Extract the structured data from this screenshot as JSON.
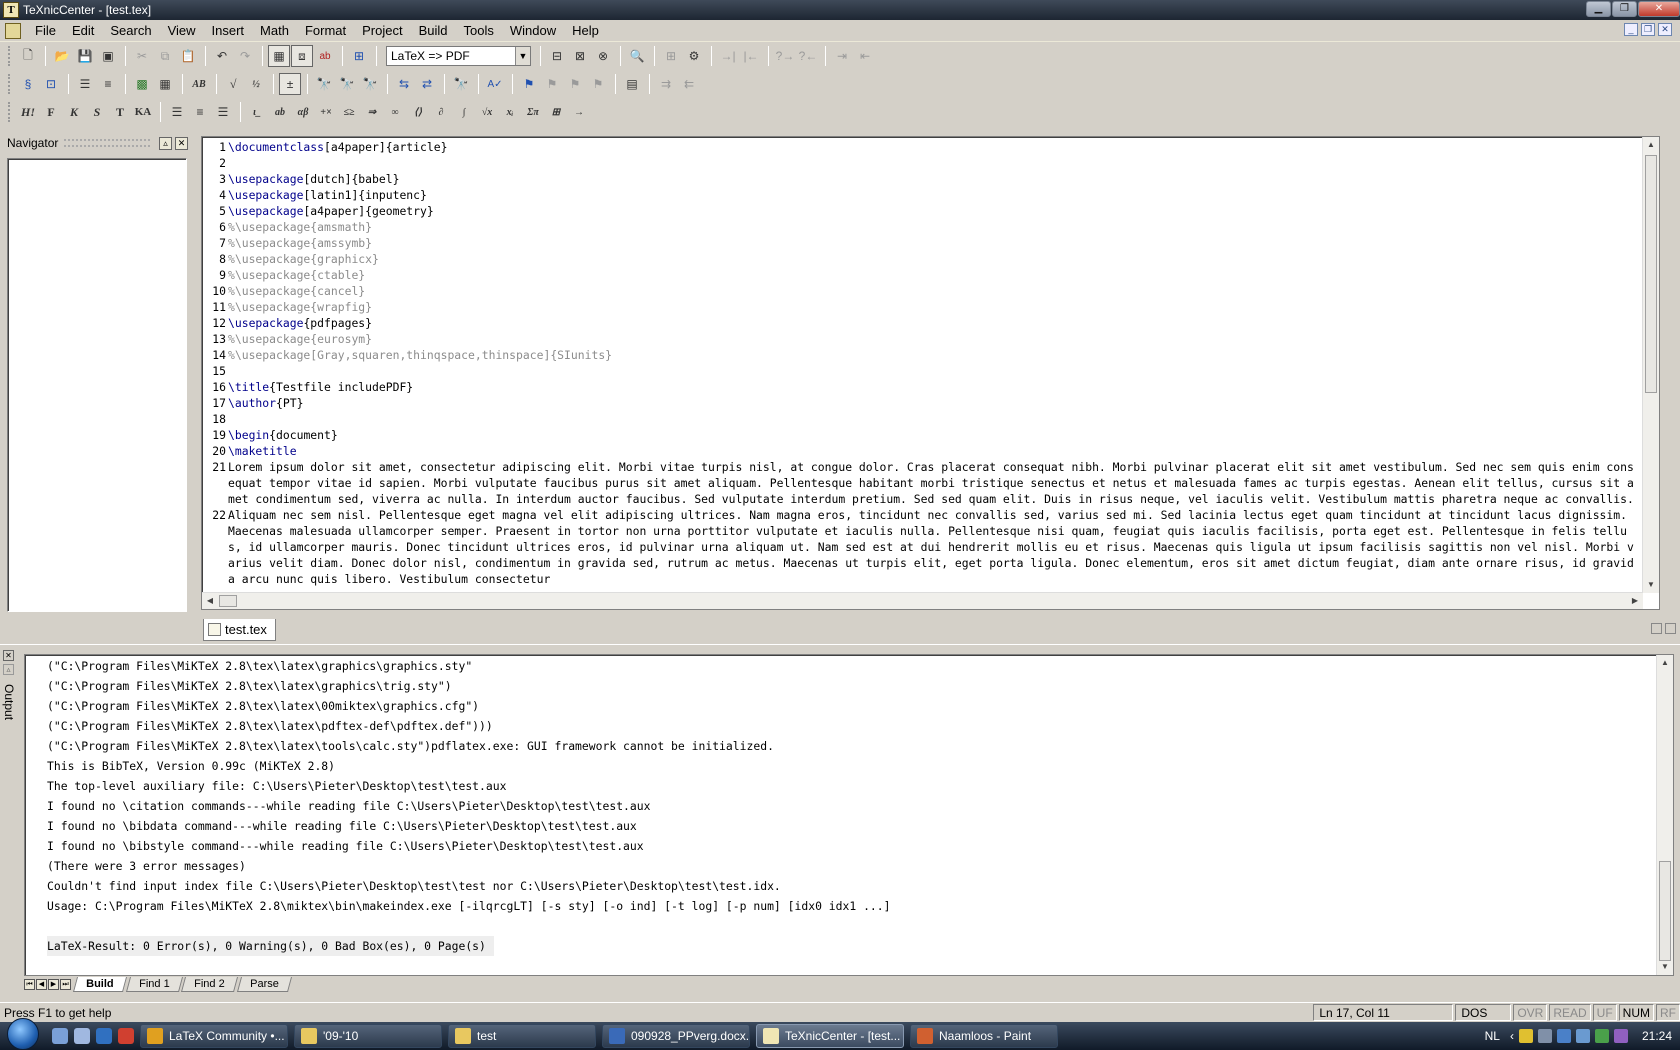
{
  "window": {
    "title": "TeXnicCenter - [test.tex]"
  },
  "menu": [
    "File",
    "Edit",
    "Search",
    "View",
    "Insert",
    "Math",
    "Format",
    "Project",
    "Build",
    "Tools",
    "Window",
    "Help"
  ],
  "toolbar": {
    "profile": "LaTeX => PDF"
  },
  "navigator": {
    "title": "Navigator"
  },
  "editor": {
    "lines": [
      {
        "n": "1",
        "segs": [
          {
            "t": "\\documentclass",
            "c": "kw"
          },
          {
            "t": "[a4paper]{article}",
            "c": ""
          }
        ]
      },
      {
        "n": "2",
        "segs": []
      },
      {
        "n": "3",
        "segs": [
          {
            "t": "\\usepackage",
            "c": "kw"
          },
          {
            "t": "[dutch]{babel}",
            "c": ""
          }
        ]
      },
      {
        "n": "4",
        "segs": [
          {
            "t": "\\usepackage",
            "c": "kw"
          },
          {
            "t": "[latin1]{inputenc}",
            "c": ""
          }
        ]
      },
      {
        "n": "5",
        "segs": [
          {
            "t": "\\usepackage",
            "c": "kw"
          },
          {
            "t": "[a4paper]{geometry}",
            "c": ""
          }
        ]
      },
      {
        "n": "6",
        "segs": [
          {
            "t": "%\\usepackage{amsmath}",
            "c": "cm"
          }
        ]
      },
      {
        "n": "7",
        "segs": [
          {
            "t": "%\\usepackage{amssymb}",
            "c": "cm"
          }
        ]
      },
      {
        "n": "8",
        "segs": [
          {
            "t": "%\\usepackage{graphicx}",
            "c": "cm"
          }
        ]
      },
      {
        "n": "9",
        "segs": [
          {
            "t": "%\\usepackage{ctable}",
            "c": "cm"
          }
        ]
      },
      {
        "n": "10",
        "segs": [
          {
            "t": "%\\usepackage{cancel}",
            "c": "cm"
          }
        ]
      },
      {
        "n": "11",
        "segs": [
          {
            "t": "%\\usepackage{wrapfig}",
            "c": "cm"
          }
        ]
      },
      {
        "n": "12",
        "segs": [
          {
            "t": "\\usepackage",
            "c": "kw"
          },
          {
            "t": "{pdfpages}",
            "c": ""
          }
        ]
      },
      {
        "n": "13",
        "segs": [
          {
            "t": "%\\usepackage{eurosym}",
            "c": "cm"
          }
        ]
      },
      {
        "n": "14",
        "segs": [
          {
            "t": "%\\usepackage[Gray,squaren,thinqspace,thinspace]{SIunits}",
            "c": "cm"
          }
        ]
      },
      {
        "n": "15",
        "segs": []
      },
      {
        "n": "16",
        "segs": [
          {
            "t": "\\title",
            "c": "kw"
          },
          {
            "t": "{Testfile includePDF}",
            "c": ""
          }
        ]
      },
      {
        "n": "17",
        "segs": [
          {
            "t": "\\author",
            "c": "kw"
          },
          {
            "t": "{PT}",
            "c": ""
          }
        ]
      },
      {
        "n": "18",
        "segs": []
      },
      {
        "n": "19",
        "segs": [
          {
            "t": "\\begin",
            "c": "kw"
          },
          {
            "t": "{document}",
            "c": ""
          }
        ]
      },
      {
        "n": "20",
        "segs": [
          {
            "t": "\\maketitle",
            "c": "kw"
          }
        ]
      },
      {
        "n": "21",
        "segs": [
          {
            "t": "Lorem ipsum dolor sit amet, consectetur adipiscing elit. Morbi vitae turpis nisl, at congue dolor. Cras placerat consequat nibh. Morbi pulvinar placerat elit sit amet vestibulum. Sed nec sem quis enim consequat tempor vitae id sapien. Morbi vulputate faucibus purus sit amet aliquam. Pellentesque habitant morbi tristique senectus et netus et malesuada fames ac turpis egestas. Aenean elit tellus, cursus sit amet condimentum sed, viverra ac nulla. In interdum auctor faucibus. Sed vulputate interdum pretium. Sed sed quam elit. Duis in risus neque, vel iaculis velit. Vestibulum mattis pharetra neque ac convallis.",
            "c": ""
          }
        ]
      },
      {
        "n": "22",
        "segs": [
          {
            "t": "Aliquam nec sem nisl. Pellentesque eget magna vel elit adipiscing ultrices. Nam magna eros, tincidunt nec convallis sed, varius sed mi. Sed lacinia lectus eget quam tincidunt at tincidunt lacus dignissim. Maecenas malesuada ullamcorper semper. Praesent in tortor non urna porttitor vulputate et iaculis nulla. Pellentesque nisi quam, feugiat quis iaculis facilisis, porta eget est. Pellentesque in felis tellus, id ullamcorper mauris. Donec tincidunt ultrices eros, id pulvinar urna aliquam ut. Nam sed est at dui hendrerit mollis eu et risus. Maecenas quis ligula ut ipsum facilisis sagittis non vel nisl. Morbi varius velit diam. Donec dolor nisl, condimentum in gravida sed, rutrum ac metus. Maecenas ut turpis elit, eget porta ligula. Donec elementum, eros sit amet dictum feugiat, diam ante ornare risus, id gravida arcu nunc quis libero. Vestibulum consectetur",
            "c": ""
          }
        ]
      }
    ]
  },
  "doc_tab": "test.tex",
  "output": {
    "title": "Output",
    "lines": [
      "(\"C:\\Program Files\\MiKTeX 2.8\\tex\\latex\\graphics\\graphics.sty\"",
      "(\"C:\\Program Files\\MiKTeX 2.8\\tex\\latex\\graphics\\trig.sty\")",
      "(\"C:\\Program Files\\MiKTeX 2.8\\tex\\latex\\00miktex\\graphics.cfg\")",
      "(\"C:\\Program Files\\MiKTeX 2.8\\tex\\latex\\pdftex-def\\pdftex.def\")))",
      "(\"C:\\Program Files\\MiKTeX 2.8\\tex\\latex\\tools\\calc.sty\")pdflatex.exe: GUI framework cannot be initialized.",
      "This is BibTeX, Version 0.99c (MiKTeX 2.8)",
      "The top-level auxiliary file: C:\\Users\\Pieter\\Desktop\\test\\test.aux",
      "I found no \\citation commands---while reading file C:\\Users\\Pieter\\Desktop\\test\\test.aux",
      "I found no \\bibdata command---while reading file C:\\Users\\Pieter\\Desktop\\test\\test.aux",
      "I found no \\bibstyle command---while reading file C:\\Users\\Pieter\\Desktop\\test\\test.aux",
      "(There were 3 error messages)",
      "Couldn't find input index file C:\\Users\\Pieter\\Desktop\\test\\test nor C:\\Users\\Pieter\\Desktop\\test\\test.idx.",
      "Usage: C:\\Program Files\\MiKTeX 2.8\\miktex\\bin\\makeindex.exe [-ilqrcgLT] [-s sty] [-o ind] [-t log] [-p num] [idx0 idx1 ...]",
      ""
    ],
    "result": "LaTeX-Result: 0 Error(s), 0 Warning(s), 0 Bad Box(es), 0 Page(s)",
    "tabs": [
      "Build",
      "Find 1",
      "Find 2",
      "Parse"
    ]
  },
  "status": {
    "help": "Press F1 to get help",
    "position": "Ln 17, Col 11",
    "format": "DOS",
    "indicators": [
      "OVR",
      "READ",
      "UF",
      "NUM",
      "RF"
    ],
    "active_indicator": "NUM"
  },
  "taskbar": {
    "items": [
      {
        "label": "LaTeX Community •...",
        "color": "#e0a020"
      },
      {
        "label": "'09-'10",
        "color": "#e8c860"
      },
      {
        "label": "test",
        "color": "#e8c860"
      },
      {
        "label": "090928_PPverg.docx...",
        "color": "#3a6ab8"
      },
      {
        "label": "TeXnicCenter - [test...",
        "color": "#f0e6b4"
      },
      {
        "label": "Naamloos - Paint",
        "color": "#d06030"
      }
    ],
    "active": 4,
    "language": "NL",
    "clock": "21:24"
  }
}
